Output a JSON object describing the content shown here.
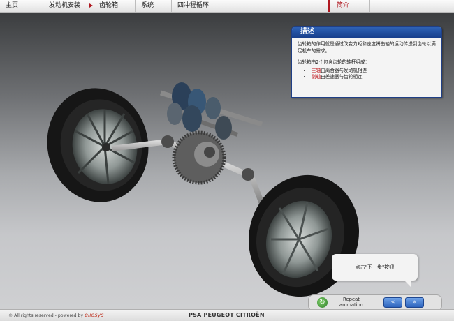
{
  "nav": {
    "items": [
      "主页",
      "发动机安装",
      "齿轮箱",
      "系统",
      "四冲程循环"
    ],
    "active_index": 2,
    "intro": "简介"
  },
  "description": {
    "title": "描述",
    "p1": "齿轮箱的作用就是通过改变力矩和速度将曲轴的运动传送到齿轮以满足机车的需求。",
    "p2": "齿轮箱由2个包含齿轮的轴杆组成：",
    "items": [
      {
        "highlight": "主轴",
        "text": "由离合器与发动机相连"
      },
      {
        "highlight": "副轴",
        "text": "由差速器与齿轮相连"
      }
    ]
  },
  "callout": "点击\"下一步\"按钮",
  "controls": {
    "repeat_label_1": "Repeat",
    "repeat_label_2": "animation",
    "prev_icon": "double-arrow-left",
    "next_icon": "double-arrow-right"
  },
  "footer": {
    "copyright": "©  All rights reserved  -  powered by",
    "brand": "eliosys",
    "company": "PSA PEUGEOT CITROËN"
  }
}
